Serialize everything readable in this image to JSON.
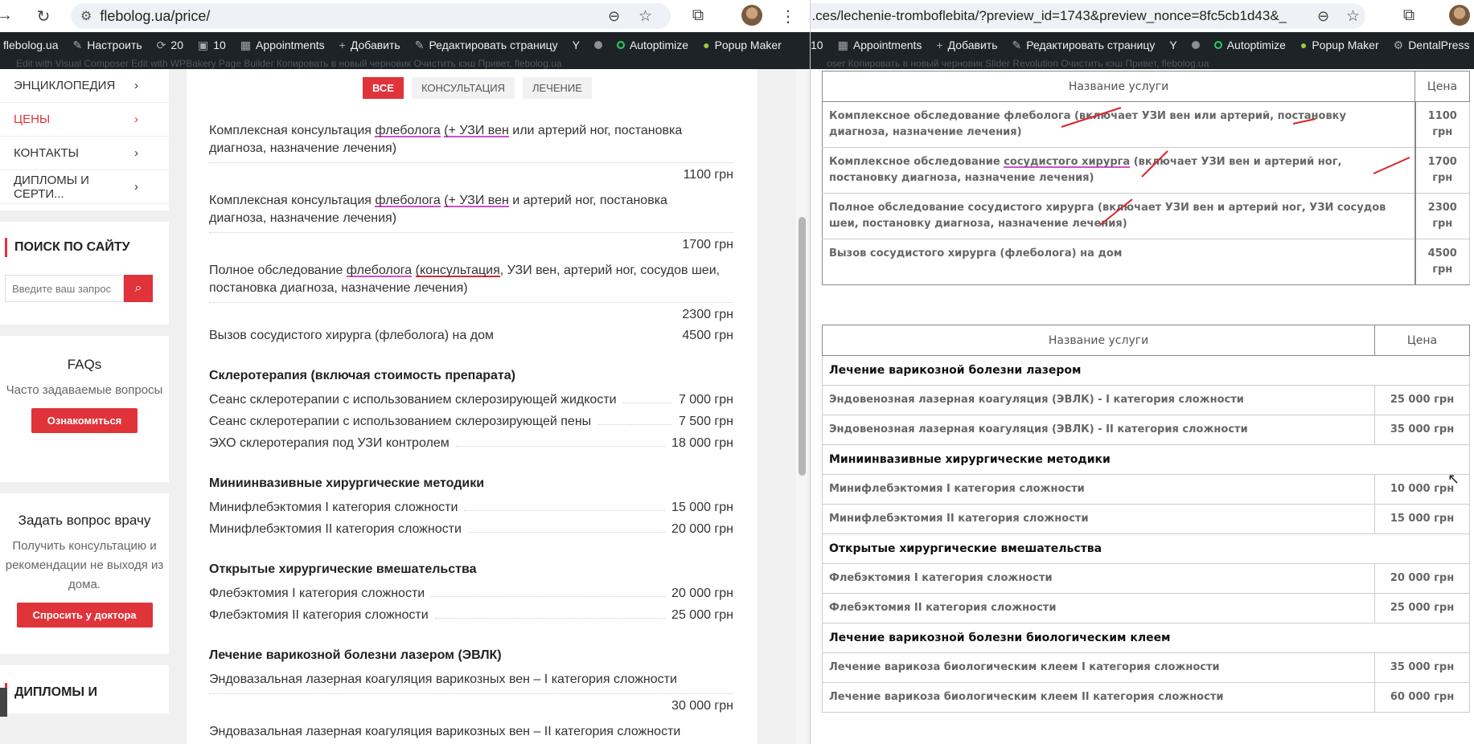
{
  "left": {
    "url": "flebolog.ua/price/",
    "wpbar": {
      "site": "flebolog.ua",
      "customize": "Настроить",
      "updates": "20",
      "comments": "10",
      "appointments": "Appointments",
      "add": "Добавить",
      "edit": "Редактировать страницу",
      "yoast": "Y",
      "autoptimize": "Autoptimize",
      "popup": "Popup Maker",
      "row2": "Edit with Visual Composer     Edit with WPBakery Page Builder     Копировать в новый черновик     Очистить кэш     Привет, flebolog.ua"
    },
    "menu": [
      "ЭНЦИКЛОПЕДИЯ",
      "ЦЕНЫ",
      "КОНТАКТЫ",
      "ДИПЛОМЫ И СЕРТИ..."
    ],
    "search": {
      "title": "ПОИСК ПО САЙТУ",
      "placeholder": "Введите ваш запрос"
    },
    "faq": {
      "title": "FAQs",
      "text": "Часто задаваемые вопросы",
      "button": "Ознакомиться"
    },
    "ask": {
      "title": "Задать вопрос врачу",
      "text": "Получить консультацию и рекомендации не выходя из дома.",
      "button": "Спросить у доктора"
    },
    "bottom_title": "ДИПЛОМЫ И",
    "filters": [
      "ВСЕ",
      "КОНСУЛЬТАЦИЯ",
      "ЛЕЧЕНИЕ"
    ],
    "consult": [
      {
        "parts": [
          "Комплексная консультация ",
          "флеболога",
          " ",
          "(+ УЗИ вен",
          " или артерий ног, постановка ",
          "диагноза, назначение лечения)"
        ],
        "price": "1100 грн"
      },
      {
        "parts": [
          "Комплексная консультация ",
          "флеболога",
          " ",
          "(+ УЗИ вен",
          " и артерий ног, постановка ",
          "диагноза, назначение лечения)"
        ],
        "price": "1700 грн"
      },
      {
        "parts": [
          "Полное обследование ",
          "флеболога",
          " ",
          "(консультация",
          ", УЗИ вен, артерий ног, сосудов шеи, ",
          "постановка диагноза, назначение лечения)"
        ],
        "price": "2300 грн"
      }
    ],
    "home_visit": {
      "name": "Вызов сосудистого хирурга (флеболога) на дом",
      "price": "4500 грн"
    },
    "sections": [
      {
        "title": "Склеротерапия (включая стоимость препарата)",
        "items": [
          {
            "name": "Сеанс склеротерапии с использованием склерозирующей жидкости",
            "price": "7 000 грн"
          },
          {
            "name": "Сеанс склеротерапии с использованием склерозирующей пены",
            "price": "7 500 грн"
          },
          {
            "name": "ЭХО склеротерапия под УЗИ контролем",
            "price": "18 000 грн"
          }
        ]
      },
      {
        "title": "Миниинвазивные хирургические методики",
        "items": [
          {
            "name": "Минифлебэктомия I категория сложности",
            "price": "15 000 грн"
          },
          {
            "name": "Минифлебэктомия II категория сложности",
            "price": "20 000 грн"
          }
        ]
      },
      {
        "title": "Открытые хирургические вмешательства",
        "items": [
          {
            "name": "Флебэктомия I категория сложности",
            "price": "20 000 грн"
          },
          {
            "name": "Флебэктомия II категория сложности",
            "price": "25 000 грн"
          }
        ]
      }
    ],
    "laser": {
      "title": "Лечение варикозной болезни лазером (ЭВЛК)",
      "item1_name": "Эндовазальная лазерная коагуляция варикозных вен – I категория сложности",
      "item1_price": "30 000 грн",
      "item2_name": "Эндовазальная лазерная коагуляция варикозных вен – II категория сложности"
    }
  },
  "right": {
    "url": "...ces/lechenie-tromboflebita/?preview_id=1743&preview_nonce=8fc5cb1d43&_...",
    "wpbar": {
      "comments": "10",
      "appointments": "Appointments",
      "add": "Добавить",
      "edit": "Редактировать страницу",
      "autoptimize": "Autoptimize",
      "popup": "Popup Maker",
      "dental": "DentalPress",
      "row2": "oser     Копировать в новый черновик     Slider Revolution              Очистить кэш     Привет, flebolog.ua"
    },
    "table1": {
      "headers": [
        "Название услуги",
        "Цена"
      ],
      "rows": [
        {
          "parts": [
            "Комплексное обследование флеболога (включает УЗИ вен или артерий, постановку диагноза, назначение лечения)"
          ],
          "price": "1100 грн"
        },
        {
          "parts": [
            "Комплексное обследование ",
            "сосудистого хирурга",
            " (включает УЗИ вен и артерий ног, постановку диагноза, назначение лечения)"
          ],
          "price": "1700 грн"
        },
        {
          "parts": [
            "Полное обследование сосудистого хирурга (включает УЗИ вен и артерий ног, УЗИ сосудов шеи, постановку диагноза, назначение лечения)"
          ],
          "price": "2300 грн"
        },
        {
          "parts": [
            "Вызов сосудистого хирурга (флеболога) на дом"
          ],
          "price": "4500 грн"
        }
      ]
    },
    "table2": {
      "headers": [
        "Название услуги",
        "Цена"
      ],
      "rows": [
        {
          "cat": "Лечение варикозной болезни лазером"
        },
        {
          "name": "Эндовенозная лазерная коагуляция (ЭВЛК) - I категория сложности",
          "price": "25 000 грн"
        },
        {
          "name": "Эндовенозная лазерная коагуляция (ЭВЛК) - II категория сложности",
          "price": "35 000 грн"
        },
        {
          "cat": "Миниинвазивные хирургические методики"
        },
        {
          "name": "Минифлебэктомия I категория сложности",
          "price": "10 000 грн"
        },
        {
          "name": "Минифлебэктомия II категория сложности",
          "price": "15 000 грн"
        },
        {
          "cat": "Открытые хирургические вмешательства"
        },
        {
          "name": "Флебэктомия I категория сложности",
          "price": "20 000 грн"
        },
        {
          "name": "Флебэктомия II категория сложности",
          "price": "25 000 грн"
        },
        {
          "cat": "Лечение варикозной болезни биологическим клеем"
        },
        {
          "name": "Лечение варикоза биологическим клеем I категория сложности",
          "price": "35 000 грн"
        },
        {
          "name": "Лечение варикоза биологическим клеем II категория сложности",
          "price": "60 000 грн"
        }
      ]
    }
  }
}
